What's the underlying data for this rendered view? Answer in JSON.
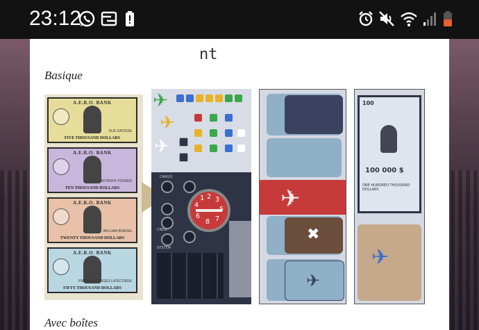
{
  "status_bar": {
    "time": "23:12",
    "left_icons": [
      "whatsapp-icon",
      "transfer-icon",
      "battery-saver-icon"
    ],
    "right_icons": [
      "alarm-icon",
      "mute-icon",
      "wifi-icon",
      "signal-icon",
      "battery-icon"
    ]
  },
  "page": {
    "top_heading_fragment": "nt",
    "sections": [
      {
        "label": "Basique"
      },
      {
        "label": "Avec boîtes"
      }
    ]
  },
  "image": {
    "bills": [
      {
        "header": "A.E.R.O.          BANK",
        "value": "FIVE THOUSAND DOLLARS",
        "signature": "GUS GROSSE",
        "color": "#e6dd9a"
      },
      {
        "header": "A.E.R.O.          BANK",
        "value": "TEN THOUSAND DOLLARS",
        "signature": "ANTHONY FOKKER",
        "color": "#c9b6dd"
      },
      {
        "header": "A.E.R.O.          BANK",
        "value": "TWENTY THOUSAND DOLLARS",
        "signature": "WILLIAM BOEING",
        "color": "#e8c1a8"
      },
      {
        "header": "A.E.R.O.          BANK",
        "value": "FIFTY THOUSAND DOLLARS",
        "signature": "PIERRE-GEORGES LATÉCOÈRE",
        "color": "#b9d6e3"
      }
    ],
    "board_labels": [
      "CARGO",
      "CREW",
      "SYSTEM"
    ],
    "gauge_numbers": [
      "1",
      "2",
      "3",
      "4",
      "5",
      "6",
      "7",
      "8"
    ],
    "big_bill": {
      "amount": "100 000 $",
      "side_text": "ONE HUNDRED THOUSAND DOLLARS",
      "corner": "100"
    },
    "colors": {
      "red": "#c73a3a",
      "navy": "#2e3446",
      "panel_blue": "#8fb0c6"
    }
  }
}
